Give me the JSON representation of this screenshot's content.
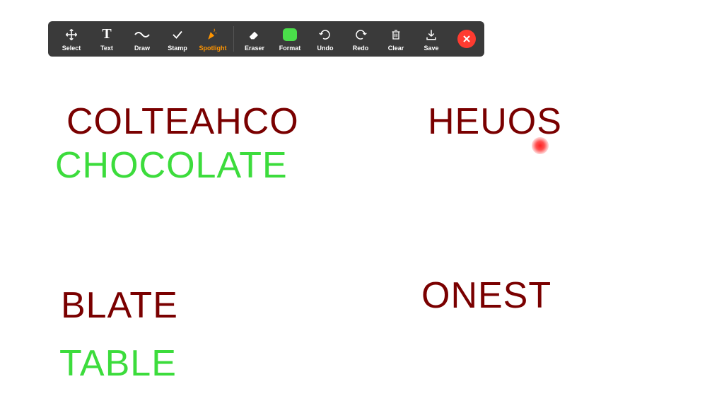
{
  "toolbar": {
    "tools": [
      {
        "name": "select",
        "label": "Select"
      },
      {
        "name": "text",
        "label": "Text"
      },
      {
        "name": "draw",
        "label": "Draw"
      },
      {
        "name": "stamp",
        "label": "Stamp"
      },
      {
        "name": "spotlight",
        "label": "Spotlight"
      },
      {
        "name": "eraser",
        "label": "Eraser"
      },
      {
        "name": "format",
        "label": "Format"
      },
      {
        "name": "undo",
        "label": "Undo"
      },
      {
        "name": "redo",
        "label": "Redo"
      },
      {
        "name": "clear",
        "label": "Clear"
      },
      {
        "name": "save",
        "label": "Save"
      }
    ],
    "active_tool": "spotlight"
  },
  "words": {
    "scrambled1": "COLTEAHCO",
    "answer1": "CHOCOLATE",
    "scrambled2": "HEUOS",
    "scrambled3": "BLATE",
    "answer3": "TABLE",
    "scrambled4": "ONEST"
  },
  "colors": {
    "scrambled": "#7a0000",
    "answer": "#3cdc3c",
    "toolbar_bg": "#3a3a3a",
    "active": "#ff9500",
    "close": "#ff3b30",
    "format": "#4ade4a"
  }
}
